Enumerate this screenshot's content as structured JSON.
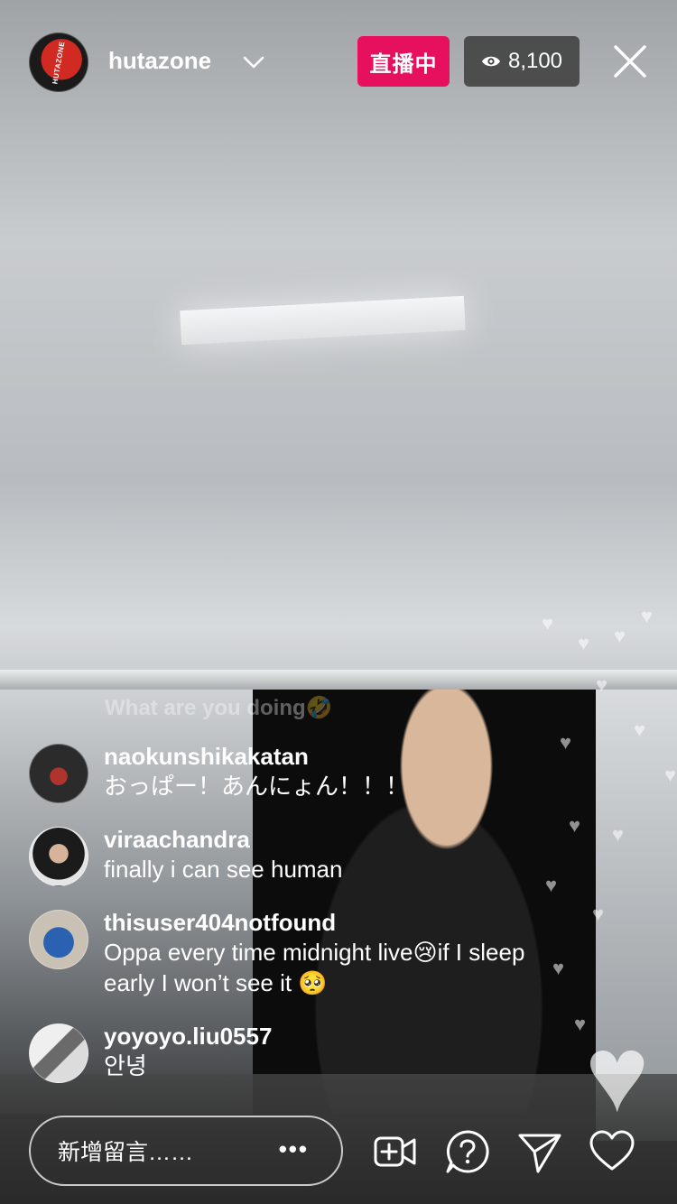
{
  "header": {
    "host_avatar_text": "HUTAZONE",
    "host_name": "hutazone",
    "live_label": "直播中",
    "viewer_count": "8,100"
  },
  "faded_comment": "What are you doing🤣",
  "comments": [
    {
      "user": "naokunshikakatan",
      "text": "おっぱー！あんにょん！！！"
    },
    {
      "user": "viraachandra",
      "text": "finally i can see human"
    },
    {
      "user": "thisuser404notfound",
      "text": "Oppa every time midnight live😢if I sleep early I won’t see it 🥺"
    },
    {
      "user": "yoyoyo.liu0557",
      "text": "안녕"
    }
  ],
  "bottom": {
    "comment_placeholder": "新增留言……",
    "more_label": "•••"
  },
  "colors": {
    "live_badge": "#e6105f",
    "viewer_badge": "#3c3c3c",
    "text": "#ffffff"
  },
  "icons": {
    "chevron": "chevron-down-icon",
    "eye": "eye-icon",
    "close": "close-icon",
    "add_video": "add-video-icon",
    "question": "question-icon",
    "send": "send-icon",
    "heart": "heart-icon"
  }
}
